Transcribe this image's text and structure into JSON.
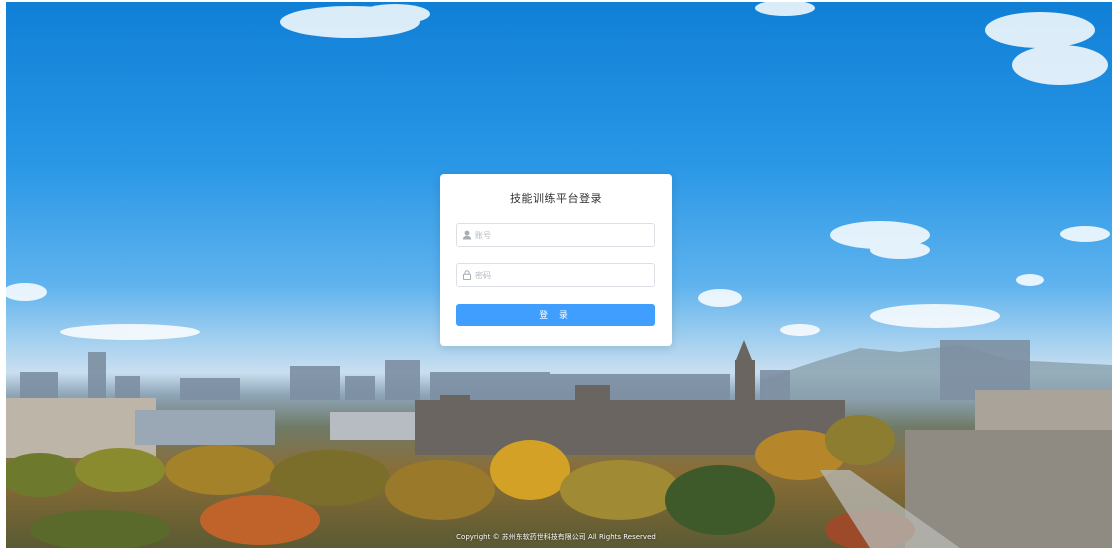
{
  "login": {
    "title": "技能训练平台登录",
    "account_placeholder": "账号",
    "password_placeholder": "密码",
    "submit_label": "登 录"
  },
  "footer": {
    "copyright": "Copyright © 苏州东软药世科技有限公司 All Rights Reserved"
  },
  "icons": {
    "account": "user-icon",
    "password": "lock-icon"
  },
  "colors": {
    "primary": "#409eff",
    "card": "#ffffff",
    "sky": "#1a86dc"
  }
}
